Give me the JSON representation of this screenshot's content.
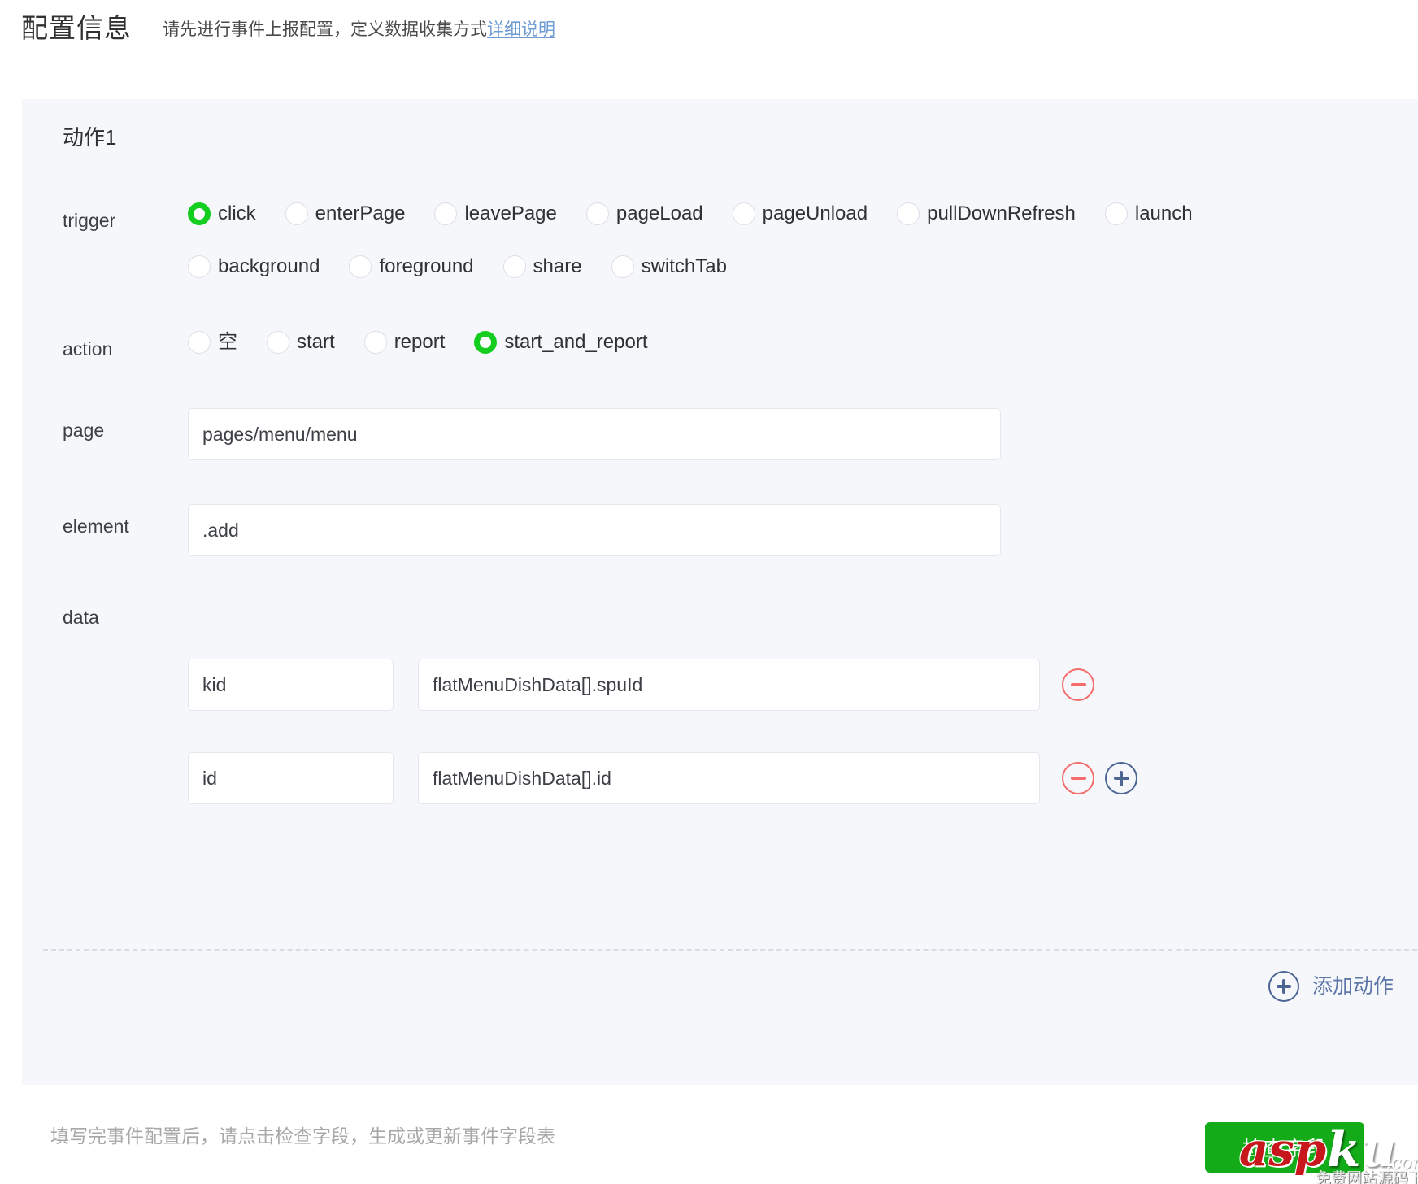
{
  "header": {
    "title": "配置信息",
    "subtitle": "请先进行事件上报配置，定义数据收集方式",
    "link": "详细说明"
  },
  "card": {
    "action_title": "动作1",
    "labels": {
      "trigger": "trigger",
      "action": "action",
      "page": "page",
      "element": "element",
      "data": "data"
    },
    "trigger": {
      "selected": "click",
      "row1": [
        {
          "label": "click",
          "checked": true
        },
        {
          "label": "enterPage",
          "checked": false
        },
        {
          "label": "leavePage",
          "checked": false
        },
        {
          "label": "pageLoad",
          "checked": false
        },
        {
          "label": "pageUnload",
          "checked": false
        },
        {
          "label": "pullDownRefresh",
          "checked": false
        },
        {
          "label": "launch",
          "checked": false
        }
      ],
      "row2": [
        {
          "label": "background",
          "checked": false
        },
        {
          "label": "foreground",
          "checked": false
        },
        {
          "label": "share",
          "checked": false
        },
        {
          "label": "switchTab",
          "checked": false
        }
      ]
    },
    "action": {
      "selected": "start_and_report",
      "options": [
        {
          "label": "空",
          "checked": false
        },
        {
          "label": "start",
          "checked": false
        },
        {
          "label": "report",
          "checked": false
        },
        {
          "label": "start_and_report",
          "checked": true
        }
      ]
    },
    "page_value": "pages/menu/menu",
    "element_value": ".add",
    "data_rows": [
      {
        "key": "kid",
        "value": "flatMenuDishData[].spuId",
        "has_remove": true,
        "has_add": false
      },
      {
        "key": "id",
        "value": "flatMenuDishData[].id",
        "has_remove": true,
        "has_add": true
      }
    ],
    "add_action_label": "添加动作"
  },
  "footer": {
    "note": "填写完事件配置后，请点击检查字段，生成或更新事件字段表",
    "button_label": "检查字段"
  },
  "watermark": {
    "part1": "asp",
    "part2": "ku",
    "part3": ".com",
    "part4": "免费网站源码下载站!"
  },
  "colors": {
    "accent_green": "#13ce1e",
    "button_green": "#13ac18",
    "remove_red": "#f56c6c",
    "add_blue": "#4d6593",
    "link_blue": "#6e9bd2",
    "card_bg": "#f5f7fa"
  }
}
